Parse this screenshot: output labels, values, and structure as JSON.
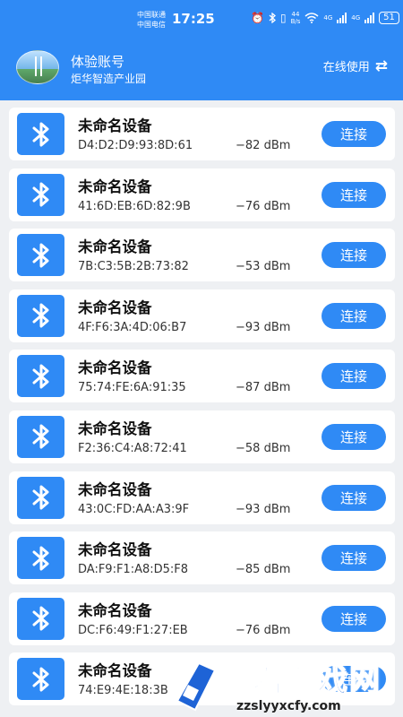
{
  "status_bar": {
    "carrier_1": "中国联通",
    "carrier_2": "中国电信",
    "time": "17:25",
    "net_speed_top": "44",
    "net_speed_bottom": "B/s",
    "signal_1": "4G",
    "signal_2": "4G",
    "battery": "51",
    "icons": [
      "alarm-icon",
      "bluetooth-icon",
      "vibrate-icon",
      "wifi-icon",
      "signal-icon",
      "battery-icon"
    ]
  },
  "header": {
    "account_title": "体验账号",
    "account_subtitle": "炬华智造产业园",
    "online_label": "在线使用",
    "swap_icon": "⇄"
  },
  "devices": [
    {
      "name": "未命名设备",
      "mac": "D4:D2:D9:93:8D:61",
      "rssi": "−82 dBm",
      "action": "连接"
    },
    {
      "name": "未命名设备",
      "mac": "41:6D:EB:6D:82:9B",
      "rssi": "−76 dBm",
      "action": "连接"
    },
    {
      "name": "未命名设备",
      "mac": "7B:C3:5B:2B:73:82",
      "rssi": "−53 dBm",
      "action": "连接"
    },
    {
      "name": "未命名设备",
      "mac": "4F:F6:3A:4D:06:B7",
      "rssi": "−93 dBm",
      "action": "连接"
    },
    {
      "name": "未命名设备",
      "mac": "75:74:FE:6A:91:35",
      "rssi": "−87 dBm",
      "action": "连接"
    },
    {
      "name": "未命名设备",
      "mac": "F2:36:C4:A8:72:41",
      "rssi": "−58 dBm",
      "action": "连接"
    },
    {
      "name": "未命名设备",
      "mac": "43:0C:FD:AA:A3:9F",
      "rssi": "−93 dBm",
      "action": "连接"
    },
    {
      "name": "未命名设备",
      "mac": "DA:F9:F1:A8:D5:F8",
      "rssi": "−85 dBm",
      "action": "连接"
    },
    {
      "name": "未命名设备",
      "mac": "DC:F6:49:F1:27:EB",
      "rssi": "−76 dBm",
      "action": "连接"
    },
    {
      "name": "未命名设备",
      "mac": "74:E9:4E:18:3B",
      "rssi": "",
      "action": "连接"
    }
  ],
  "watermark": {
    "text": "智君游戏网",
    "url": "zzslyyxcfy.com"
  },
  "colors": {
    "primary": "#2f8af5",
    "background": "#eef0f3",
    "card": "#ffffff"
  }
}
